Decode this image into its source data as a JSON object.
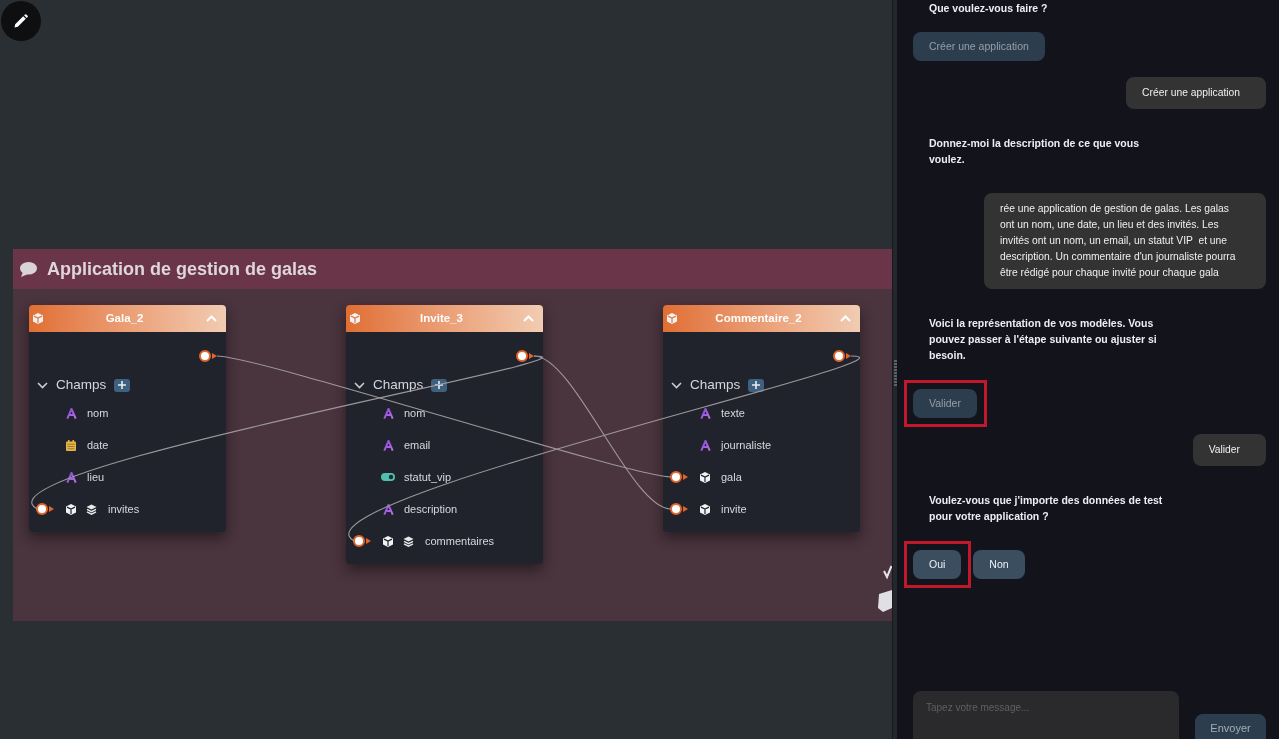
{
  "diagram": {
    "title": "Application de gestion de galas",
    "cards": [
      {
        "title": "Gala_2",
        "section": "Champs",
        "fields": [
          {
            "name": "nom",
            "kind": "text"
          },
          {
            "name": "date",
            "kind": "date"
          },
          {
            "name": "lieu",
            "kind": "text"
          },
          {
            "name": "invites",
            "kind": "relation_list"
          }
        ]
      },
      {
        "title": "Invite_3",
        "section": "Champs",
        "fields": [
          {
            "name": "nom",
            "kind": "text"
          },
          {
            "name": "email",
            "kind": "text"
          },
          {
            "name": "statut_vip",
            "kind": "boolean"
          },
          {
            "name": "description",
            "kind": "text"
          },
          {
            "name": "commentaires",
            "kind": "relation_list"
          }
        ]
      },
      {
        "title": "Commentaire_2",
        "section": "Champs",
        "fields": [
          {
            "name": "texte",
            "kind": "text"
          },
          {
            "name": "journaliste",
            "kind": "text"
          },
          {
            "name": "gala",
            "kind": "relation"
          },
          {
            "name": "invite",
            "kind": "relation"
          }
        ]
      }
    ]
  },
  "chat": {
    "messages": [
      {
        "kind": "bot",
        "text": "Que voulez-vous faire ?"
      },
      {
        "kind": "choices",
        "buttons": [
          {
            "label": "Créer une application",
            "disabled": true,
            "highlighted": false
          }
        ]
      },
      {
        "kind": "user",
        "text": "Créer une application"
      },
      {
        "kind": "bot",
        "text": "Donnez-moi la description de ce que vous voulez."
      },
      {
        "kind": "user",
        "text": "rée une application de gestion de galas. Les galas ont un nom, une date, un lieu et des invités. Les invités ont un nom, un email, un statut VIP  et une description. Un commentaire d'un journaliste pourra être rédigé pour chaque invité pour chaque gala"
      },
      {
        "kind": "bot",
        "text": "Voici la représentation de vos modèles. Vous pouvez passer à l'étape suivante ou ajuster si besoin."
      },
      {
        "kind": "choices",
        "buttons": [
          {
            "label": "Valider",
            "disabled": true,
            "highlighted": true
          }
        ]
      },
      {
        "kind": "user",
        "text": "Valider"
      },
      {
        "kind": "bot",
        "text": "Voulez-vous que j'importe des données de test pour votre application ?"
      },
      {
        "kind": "choices",
        "buttons": [
          {
            "label": "Oui",
            "disabled": false,
            "highlighted": true
          },
          {
            "label": "Non",
            "disabled": false,
            "highlighted": false
          }
        ]
      }
    ],
    "input": {
      "placeholder": "Tapez votre message..."
    },
    "send_button": {
      "label": "Envoyer",
      "disabled": true
    }
  }
}
